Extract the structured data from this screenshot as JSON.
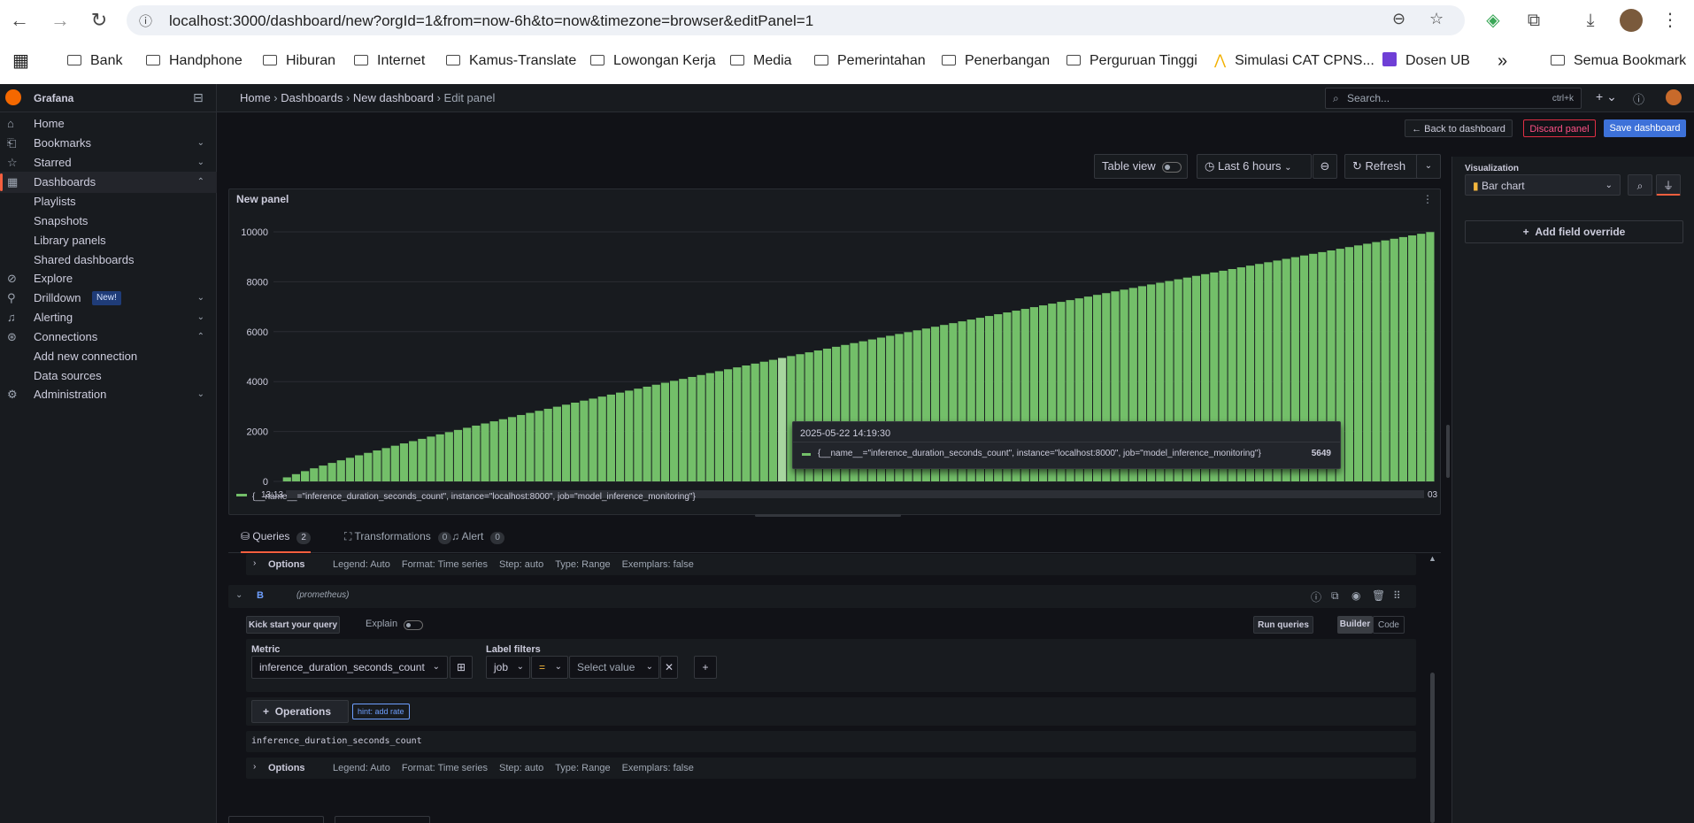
{
  "browser": {
    "url": "localhost:3000/dashboard/new?orgId=1&from=now-6h&to=now&timezone=browser&editPanel=1",
    "bookmarks": [
      "Bank",
      "Handphone",
      "Hiburan",
      "Internet",
      "Kamus-Translate",
      "Lowongan Kerja",
      "Media",
      "Pemerintahan",
      "Penerbangan",
      "Perguruan Tinggi",
      "Simulasi CAT CPNS...",
      "Dosen UB"
    ],
    "all_bookmarks": "Semua Bookmark",
    "more": "»"
  },
  "app": {
    "name": "Grafana",
    "breadcrumb": [
      "Home",
      "Dashboards",
      "New dashboard",
      "Edit panel"
    ],
    "search_placeholder": "Search...",
    "search_shortcut": "ctrl+k",
    "plus": "+"
  },
  "sidebar": {
    "items": [
      {
        "label": "Home",
        "icon": "home-icon",
        "chev": ""
      },
      {
        "label": "Bookmarks",
        "icon": "bookmark-icon",
        "chev": "⌄"
      },
      {
        "label": "Starred",
        "icon": "star-icon",
        "chev": "⌄"
      },
      {
        "label": "Dashboards",
        "icon": "apps-icon",
        "chev": "⌃",
        "active": true
      },
      {
        "label": "Playlists",
        "sub": true
      },
      {
        "label": "Snapshots",
        "sub": true
      },
      {
        "label": "Library panels",
        "sub": true
      },
      {
        "label": "Shared dashboards",
        "sub": true
      },
      {
        "label": "Explore",
        "icon": "compass-icon",
        "chev": ""
      },
      {
        "label": "Drilldown",
        "icon": "drilldown-icon",
        "chev": "⌄",
        "badge": "New!"
      },
      {
        "label": "Alerting",
        "icon": "bell-icon",
        "chev": "⌄"
      },
      {
        "label": "Connections",
        "icon": "link-icon",
        "chev": "⌃"
      },
      {
        "label": "Add new connection",
        "sub": true
      },
      {
        "label": "Data sources",
        "sub": true
      },
      {
        "label": "Administration",
        "icon": "cog-icon",
        "chev": "⌄"
      }
    ]
  },
  "actions": {
    "back": "← Back to dashboard",
    "discard": "Discard panel",
    "save": "Save dashboard"
  },
  "toolbar": {
    "table_view": "Table view",
    "time_range": "Last 6 hours",
    "refresh": "Refresh"
  },
  "panel": {
    "title": "New panel",
    "legend": "{__name__=\"inference_duration_seconds_count\", instance=\"localhost:8000\", job=\"model_inference_monitoring\"}",
    "tooltip": {
      "time": "2025-05-22 14:19:30",
      "series": "{__name__=\"inference_duration_seconds_count\", instance=\"localhost:8000\", job=\"model_inference_monitoring\"}",
      "value": "5649",
      "bar_index": 56
    },
    "x_first": "13:13",
    "x_last": "03"
  },
  "chart_data": {
    "type": "bar",
    "series": [
      {
        "name": "{__name__=\"inference_duration_seconds_count\", instance=\"localhost:8000\", job=\"model_inference_monitoring\"}",
        "start": 0,
        "end": 9990,
        "count": 129
      }
    ],
    "y_ticks": [
      0,
      2000,
      4000,
      6000,
      8000,
      10000
    ],
    "ylim": [
      0,
      10000
    ],
    "color": "#73bf69",
    "grid": true,
    "legend": "bottom"
  },
  "query_tabs": [
    {
      "label": "Queries",
      "count": "2"
    },
    {
      "label": "Transformations",
      "count": "0"
    },
    {
      "label": "Alert",
      "count": "0"
    }
  ],
  "query_a_options": {
    "label": "Options",
    "summary": [
      "Legend: Auto",
      "Format: Time series",
      "Step: auto",
      "Type: Range",
      "Exemplars: false"
    ]
  },
  "query_b": {
    "letter": "B",
    "datasource": "(prometheus)",
    "kick_start": "Kick start your query",
    "explain": "Explain",
    "run": "Run queries",
    "builder": "Builder",
    "code": "Code",
    "metric_label": "Metric",
    "metric": "inference_duration_seconds_count",
    "label_filters": "Label filters",
    "filter_label": "job",
    "filter_op": "=",
    "filter_value": "Select value",
    "operations": "Operations",
    "hint": "hint: add rate",
    "raw": "inference_duration_seconds_count",
    "options": {
      "label": "Options",
      "summary": [
        "Legend: Auto",
        "Format: Time series",
        "Step: auto",
        "Type: Range",
        "Exemplars: false"
      ]
    }
  },
  "right": {
    "viz_label": "Visualization",
    "viz": "Bar chart",
    "add_override": "Add field override"
  }
}
